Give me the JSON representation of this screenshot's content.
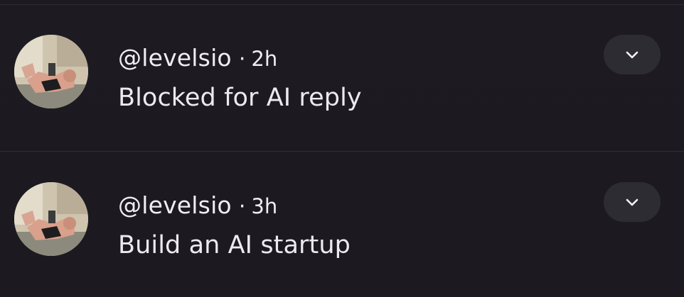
{
  "notifications": [
    {
      "handle": "@levelsio",
      "separator": "·",
      "time": "2h",
      "message": "Blocked for AI reply",
      "expand_icon": "chevron-down-icon"
    },
    {
      "handle": "@levelsio",
      "separator": "·",
      "time": "3h",
      "message": "Build an AI startup",
      "expand_icon": "chevron-down-icon"
    }
  ],
  "colors": {
    "background": "#1c1a20",
    "text": "#efedf2",
    "button_bg": "#2e2c33",
    "divider": "#2f2c34"
  }
}
